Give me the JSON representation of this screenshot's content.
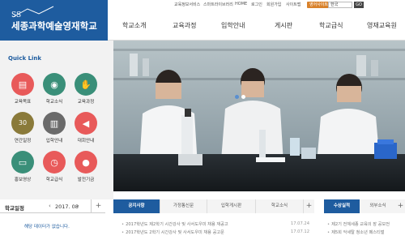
{
  "brand": {
    "logo_text": "SS",
    "school_name": "세종과학예술영재학교",
    "color": "#1e5c9f"
  },
  "utility": {
    "links": [
      "교육정보서비스",
      "스마트라이브러리",
      "HOME",
      "로그인",
      "회원가입",
      "사이트맵"
    ],
    "badge": "영어사이트",
    "lang_select": "한국",
    "go": "GO"
  },
  "gnb": [
    "학교소개",
    "교육과정",
    "입학안내",
    "게시판",
    "학교급식",
    "영재교육원"
  ],
  "quick_link": {
    "title": "Quick Link",
    "items": [
      {
        "label": "교육목표",
        "icon": "document-icon",
        "color": "#e85a5a"
      },
      {
        "label": "학교소식",
        "icon": "megaphone-icon",
        "color": "#3a8f79"
      },
      {
        "label": "교육과정",
        "icon": "hand-icon",
        "color": "#3a8f79"
      },
      {
        "label": "연간일정",
        "icon": "calendar-icon",
        "color": "#8a7a3a"
      },
      {
        "label": "입학안내",
        "icon": "book-icon",
        "color": "#6a6a6a"
      },
      {
        "label": "대회안내",
        "icon": "megaphone-icon",
        "color": "#e85a5a"
      },
      {
        "label": "홍보영상",
        "icon": "monitor-icon",
        "color": "#3a8f79"
      },
      {
        "label": "학교급식",
        "icon": "clock-icon",
        "color": "#e85a5a"
      },
      {
        "label": "발전기금",
        "icon": "piggy-icon",
        "color": "#e85a5a"
      }
    ]
  },
  "hero": {
    "dots": [
      "#5a8fd0",
      "#ffffff"
    ]
  },
  "calendar": {
    "title": "학교일정",
    "prev": "‹",
    "month": "2017. 08",
    "next": "›",
    "plus": "+",
    "empty": "해당 데이터가 없습니다."
  },
  "news": {
    "tabs": [
      "공지사항",
      "가정통신문",
      "입학게시판",
      "학교소식"
    ],
    "plus": "+",
    "rows": [
      {
        "title": "2017학년도 제2학기 시간강사 및 사서도우미 채용 재공고",
        "date": "17.07.24"
      },
      {
        "title": "2017학년도 2학기 시간강사 및 사서도우미 채용 공고문",
        "date": "17.07.12"
      }
    ]
  },
  "side_news": {
    "tabs": [
      "수상실적",
      "외부소식"
    ],
    "plus": "+",
    "rows": [
      "제2기 전체세종 교육의 장 공모전",
      "제5회 악세탈 청소년 페스티벌"
    ]
  }
}
